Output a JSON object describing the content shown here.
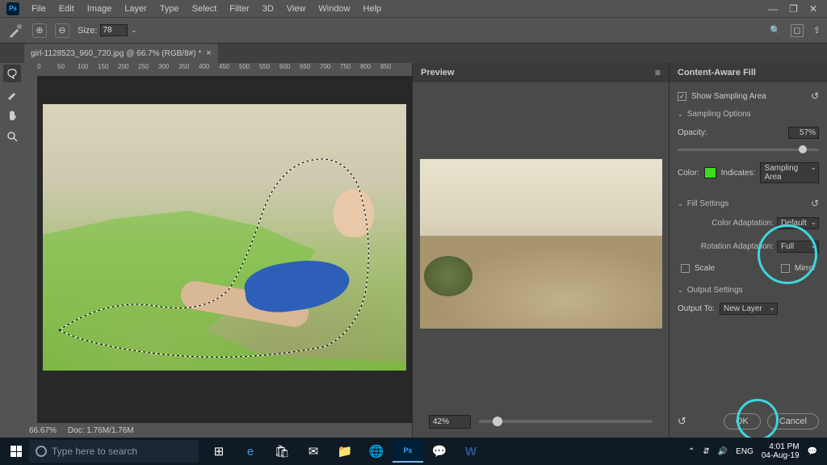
{
  "app": {
    "logo": "Ps"
  },
  "menu": {
    "items": [
      "File",
      "Edit",
      "Image",
      "Layer",
      "Type",
      "Select",
      "Filter",
      "3D",
      "View",
      "Window",
      "Help"
    ]
  },
  "options": {
    "size_label": "Size:",
    "size_value": "78"
  },
  "tab": {
    "title": "girl-1128523_960_720.jpg @ 66.7% (RGB/8#) *"
  },
  "ruler": {
    "ticks": [
      "0",
      "50",
      "100",
      "150",
      "200",
      "250",
      "300",
      "350",
      "400",
      "450",
      "500",
      "550",
      "600",
      "650",
      "700",
      "750",
      "800",
      "850"
    ]
  },
  "status": {
    "zoom": "66.67%",
    "doc_label": "Doc:",
    "doc_value": "1.76M/1.76M"
  },
  "preview": {
    "header": "Preview",
    "zoom": "42%"
  },
  "panel": {
    "title": "Content-Aware Fill",
    "show_sampling": "Show Sampling Area",
    "sampling_options": "Sampling Options",
    "opacity_label": "Opacity:",
    "opacity_value": "57%",
    "color_label": "Color:",
    "indicates_label": "Indicates:",
    "indicates_value": "Sampling Area",
    "fill_settings": "Fill Settings",
    "color_adapt_label": "Color Adaptation:",
    "color_adapt_value": "Default",
    "rotation_label": "Rotation Adaptation:",
    "rotation_value": "Full",
    "scale": "Scale",
    "mirror": "Mirror",
    "output_settings": "Output Settings",
    "output_to_label": "Output To:",
    "output_to_value": "New Layer",
    "ok": "OK",
    "cancel": "Cancel"
  },
  "taskbar": {
    "search_placeholder": "Type here to search",
    "lang": "ENG",
    "time": "4:01 PM",
    "date": "04-Aug-19"
  }
}
